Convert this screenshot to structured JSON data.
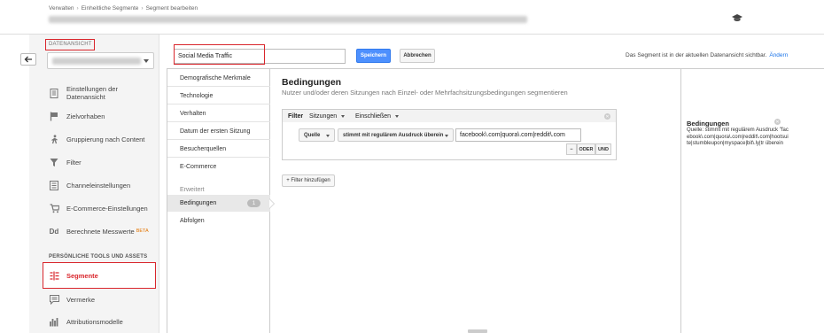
{
  "breadcrumb": [
    "Verwalten",
    "Einheitliche Segmente",
    "Segment bearbeiten"
  ],
  "breadcrumb_sep": "›",
  "view": {
    "label": "DATENANSICHT"
  },
  "sidebar": {
    "items": [
      {
        "label": "Einstellungen der Datenansicht",
        "icon": "document-icon"
      },
      {
        "label": "Zielvorhaben",
        "icon": "flag-icon"
      },
      {
        "label": "Gruppierung nach Content",
        "icon": "walk-icon"
      },
      {
        "label": "Filter",
        "icon": "filter-icon"
      },
      {
        "label": "Channeleinstellungen",
        "icon": "channel-icon"
      },
      {
        "label": "E-Commerce-Einstellungen",
        "icon": "cart-icon"
      },
      {
        "label": "Berechnete Messwerte",
        "icon": "dd-icon",
        "badge": "BETA",
        "icon_text": "Dd"
      }
    ],
    "section_title": "PERSÖNLICHE TOOLS UND ASSETS",
    "tools": [
      {
        "label": "Segmente",
        "icon": "segments-icon",
        "active": true
      },
      {
        "label": "Vermerke",
        "icon": "comment-icon"
      },
      {
        "label": "Attributionsmodelle",
        "icon": "bar-chart-icon"
      }
    ]
  },
  "segment": {
    "name_value": "Social Media Traffic",
    "save_label": "Speichern",
    "cancel_label": "Abbrechen",
    "visibility_text": "Das Segment ist in der aktuellen Datenansicht sichtbar.",
    "change_label": "Ändern"
  },
  "categories": [
    "Demografische Merkmale",
    "Technologie",
    "Verhalten",
    "Datum der ersten Sitzung",
    "Besucherquellen",
    "E-Commerce"
  ],
  "advanced": {
    "label": "Erweitert",
    "conditions_label": "Bedingungen",
    "conditions_count": "1",
    "sequences_label": "Abfolgen"
  },
  "conditions": {
    "title": "Bedingungen",
    "subtitle": "Nutzer und/oder deren Sitzungen nach Einzel- oder Mehrfachsitzungsbedingungen segmentieren",
    "filter_label": "Filter",
    "scope": "Sitzungen",
    "mode": "Einschließen",
    "dimension": "Quelle",
    "operator": "stimmt mit regulärem Ausdruck überein",
    "value": "facebook\\.com|quora\\.com|reddit\\.com",
    "minus_label": "−",
    "or_label": "ODER",
    "and_label": "UND",
    "add_filter_label": "+ Filter hinzufügen"
  },
  "summary": {
    "title": "Bedingungen",
    "text": "Quelle: stimmt mit regulärem Ausdruck \"facebook\\.com|quora\\.com|reddit\\.com|hootsuite|stumbleupon|myspace|bit\\.ly|tr überein"
  }
}
